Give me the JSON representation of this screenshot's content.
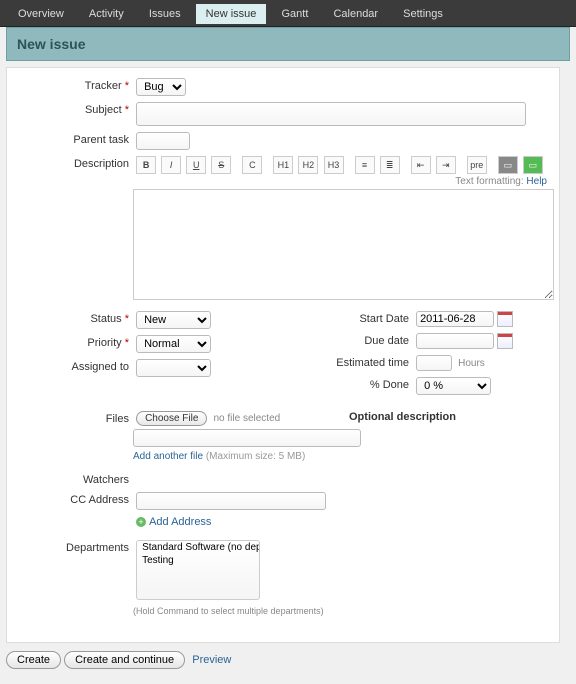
{
  "tabs": {
    "overview": "Overview",
    "activity": "Activity",
    "issues": "Issues",
    "new_issue": "New issue",
    "gantt": "Gantt",
    "calendar": "Calendar",
    "settings": "Settings"
  },
  "title": "New issue",
  "labels": {
    "tracker": "Tracker",
    "subject": "Subject",
    "parent": "Parent task",
    "description": "Description",
    "status": "Status",
    "priority": "Priority",
    "assigned": "Assigned to",
    "start": "Start Date",
    "due": "Due date",
    "estimated": "Estimated time",
    "done": "% Done",
    "files": "Files",
    "optional_desc": "Optional description",
    "watchers": "Watchers",
    "cc": "CC Address",
    "add_address": "Add Address",
    "departments": "Departments",
    "hold_hint": "(Hold Command to select multiple departments)",
    "choose_file": "Choose File",
    "no_file": "no file selected",
    "add_file": "Add another file",
    "max_size": "(Maximum size: 5 MB)",
    "hours": "Hours",
    "text_formatting": "Text formatting:",
    "help": "Help"
  },
  "values": {
    "tracker": "Bug",
    "status": "New",
    "priority": "Normal",
    "assigned": "",
    "start_date": "2011-06-28",
    "done": "0 %"
  },
  "toolbar": {
    "bold": "B",
    "italic": "I",
    "underline": "U",
    "strike": "S",
    "code": "C",
    "h1": "H1",
    "h2": "H2",
    "h3": "H3",
    "ul": "≡",
    "ol": "≣",
    "out": "⇤",
    "in": "⇥",
    "pre": "pre",
    "img": "▭",
    "link": "▭"
  },
  "departments": {
    "opt1": "Standard Software (no department)",
    "opt2": "Testing"
  },
  "buttons": {
    "create": "Create",
    "create_continue": "Create and continue",
    "preview": "Preview"
  }
}
